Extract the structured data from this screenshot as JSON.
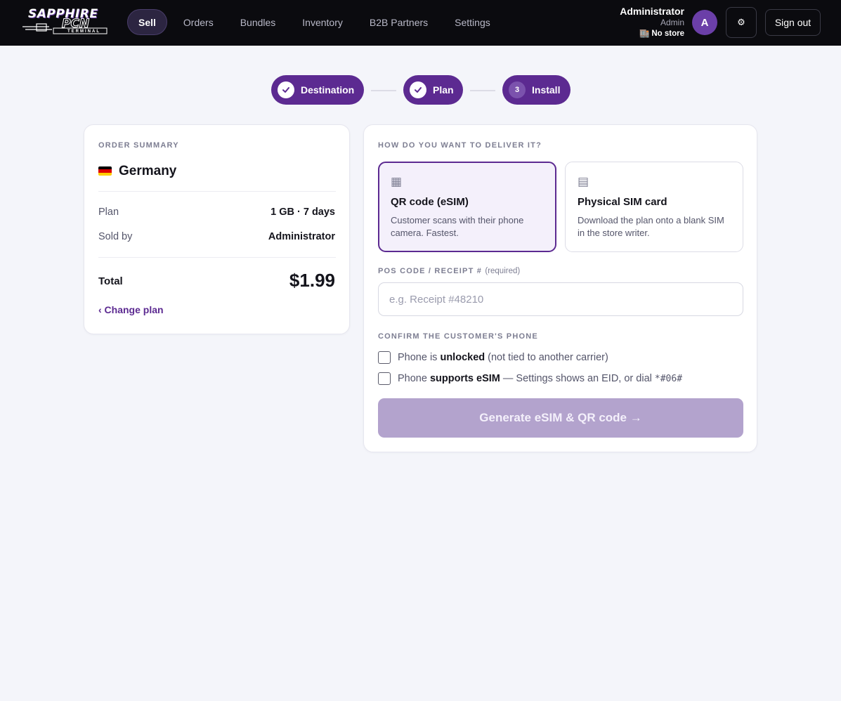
{
  "brand": {
    "logo_line1": "SAPPHIRE",
    "logo_line2": "PCN",
    "logo_line3": "TERMINAL"
  },
  "nav": {
    "items": [
      {
        "label": "Sell",
        "active": true
      },
      {
        "label": "Orders"
      },
      {
        "label": "Bundles"
      },
      {
        "label": "Inventory"
      },
      {
        "label": "B2B Partners"
      },
      {
        "label": "Settings"
      }
    ]
  },
  "user": {
    "name": "Administrator",
    "role": "Admin",
    "store_icon": "store-icon",
    "store": "No store",
    "avatar_initial": "A",
    "gear_icon": "gear-icon",
    "signout_label": "Sign out"
  },
  "stepper": {
    "steps": [
      {
        "label": "Destination",
        "state": "done",
        "icon": "check-icon"
      },
      {
        "label": "Plan",
        "state": "done",
        "icon": "check-icon"
      },
      {
        "label": "Install",
        "state": "current",
        "number": "3"
      }
    ]
  },
  "summary": {
    "heading": "ORDER SUMMARY",
    "country": "Germany",
    "flag_colors": [
      "#000000",
      "#dd0000",
      "#ffce00"
    ],
    "rows": [
      {
        "label": "Plan",
        "value": "1 GB · 7 days"
      },
      {
        "label": "Sold by",
        "value": "Administrator"
      }
    ],
    "total_label": "Total",
    "total_value": "$1.99",
    "change_plan_label": "‹ Change plan"
  },
  "delivery": {
    "heading": "HOW DO YOU WANT TO DELIVER IT?",
    "options": [
      {
        "title": "QR code (eSIM)",
        "description": "Customer scans with their phone camera. Fastest.",
        "icon": "qr-code-icon",
        "selected": true
      },
      {
        "title": "Physical SIM card",
        "description": "Download the plan onto a blank SIM in the store writer.",
        "icon": "sim-card-icon",
        "selected": false
      }
    ],
    "pos_label": "POS CODE / RECEIPT #",
    "pos_required": "(required)",
    "pos_placeholder": "e.g. Receipt #48210",
    "pos_value": "",
    "confirm_heading": "CONFIRM THE CUSTOMER'S PHONE",
    "checks": [
      {
        "prefix": "Phone is ",
        "bold": "unlocked",
        "suffix": " (not tied to another carrier)",
        "checked": false
      },
      {
        "prefix": "Phone ",
        "bold": "supports eSIM",
        "suffix": " — Settings shows an EID, or dial ",
        "code": "*#06#",
        "checked": false
      }
    ],
    "generate_label": "Generate eSIM & QR code →"
  },
  "colors": {
    "accent": "#5c2a91",
    "topbar": "#0b0b0f",
    "background": "#f4f5fa",
    "button_disabled": "#b3a3cd"
  }
}
